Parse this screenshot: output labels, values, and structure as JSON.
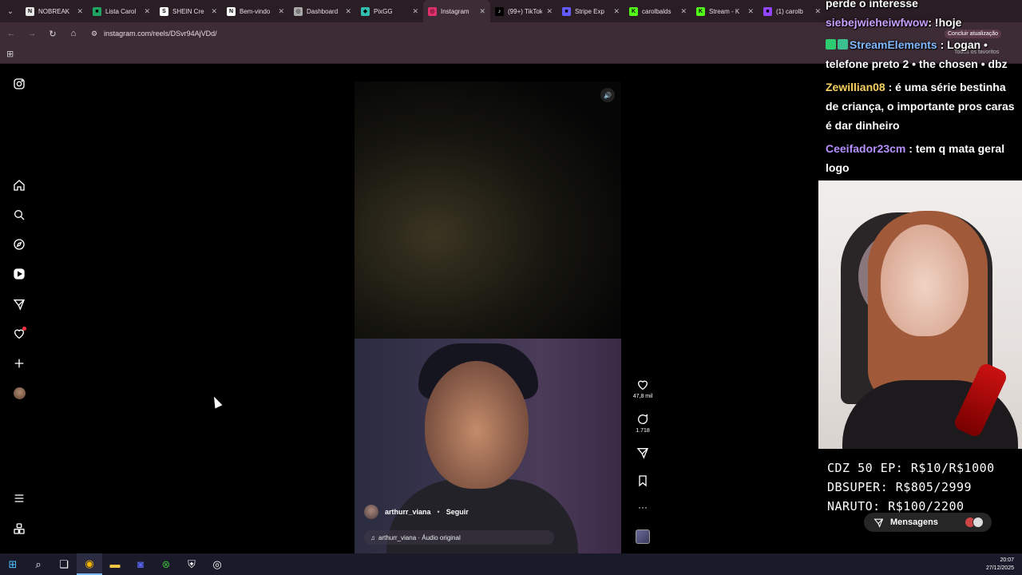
{
  "browser": {
    "tabs": [
      {
        "title": "NOBREAK",
        "favicon_color": "#e6e6e6",
        "glyph": "N"
      },
      {
        "title": "Lista Carol",
        "favicon_color": "#1fa463",
        "glyph": "■"
      },
      {
        "title": "SHEIN Cre",
        "favicon_color": "#ffffff",
        "glyph": "S"
      },
      {
        "title": "Bem-vindo",
        "favicon_color": "#ffffff",
        "glyph": "N"
      },
      {
        "title": "Dashboard",
        "favicon_color": "#aaaaaa",
        "glyph": "◎"
      },
      {
        "title": "PixGG",
        "favicon_color": "#32bcad",
        "glyph": "◆"
      },
      {
        "title": "Instagram",
        "favicon_color": "#e1306c",
        "glyph": "◎",
        "active": true
      },
      {
        "title": "(99+) TikTok",
        "favicon_color": "#000000",
        "glyph": "♪"
      },
      {
        "title": "Stripe Exp",
        "favicon_color": "#635bff",
        "glyph": "■"
      },
      {
        "title": "carolbalds",
        "favicon_color": "#53fc18",
        "glyph": "K"
      },
      {
        "title": "Stream - K",
        "favicon_color": "#53fc18",
        "glyph": "K"
      },
      {
        "title": "(1) carolb",
        "favicon_color": "#9146ff",
        "glyph": "■"
      }
    ],
    "url": "instagram.com/reels/DSvr94AjVDd/",
    "update_label": "Concluir atualização",
    "favorites_label": "Todos os favoritos"
  },
  "reel": {
    "author": "arthurr_viana",
    "follow_label": "Seguir",
    "audio": "arthurr_viana · Áudio original",
    "likes": "47,8 mil",
    "comments": "1.718"
  },
  "stream": {
    "chat": [
      {
        "user": "perde o interesse",
        "text": "",
        "cls": "u0"
      },
      {
        "user": "siebejwieheiwfwow",
        "text": ": !hoje",
        "cls": "u1"
      },
      {
        "user": "StreamElements",
        "text": ": Logan • telefone preto 2 • the chosen • dbz",
        "cls": "u2"
      },
      {
        "user": "Zewillian08",
        "text": ": é uma série bestinha de criança, o importante pros caras é dar dinheiro",
        "cls": "u3"
      },
      {
        "user": "Ceeifador23cm",
        "text": ": tem q mata geral logo",
        "cls": "u4"
      }
    ],
    "prices": [
      "CDZ 50 EP: R$10/R$1000",
      "DBSUPER: R$805/2999",
      "NARUTO: R$100/2200"
    ],
    "messages_label": "Mensagens"
  },
  "taskbar": {
    "time": "20:07",
    "date": "27/12/2025"
  }
}
